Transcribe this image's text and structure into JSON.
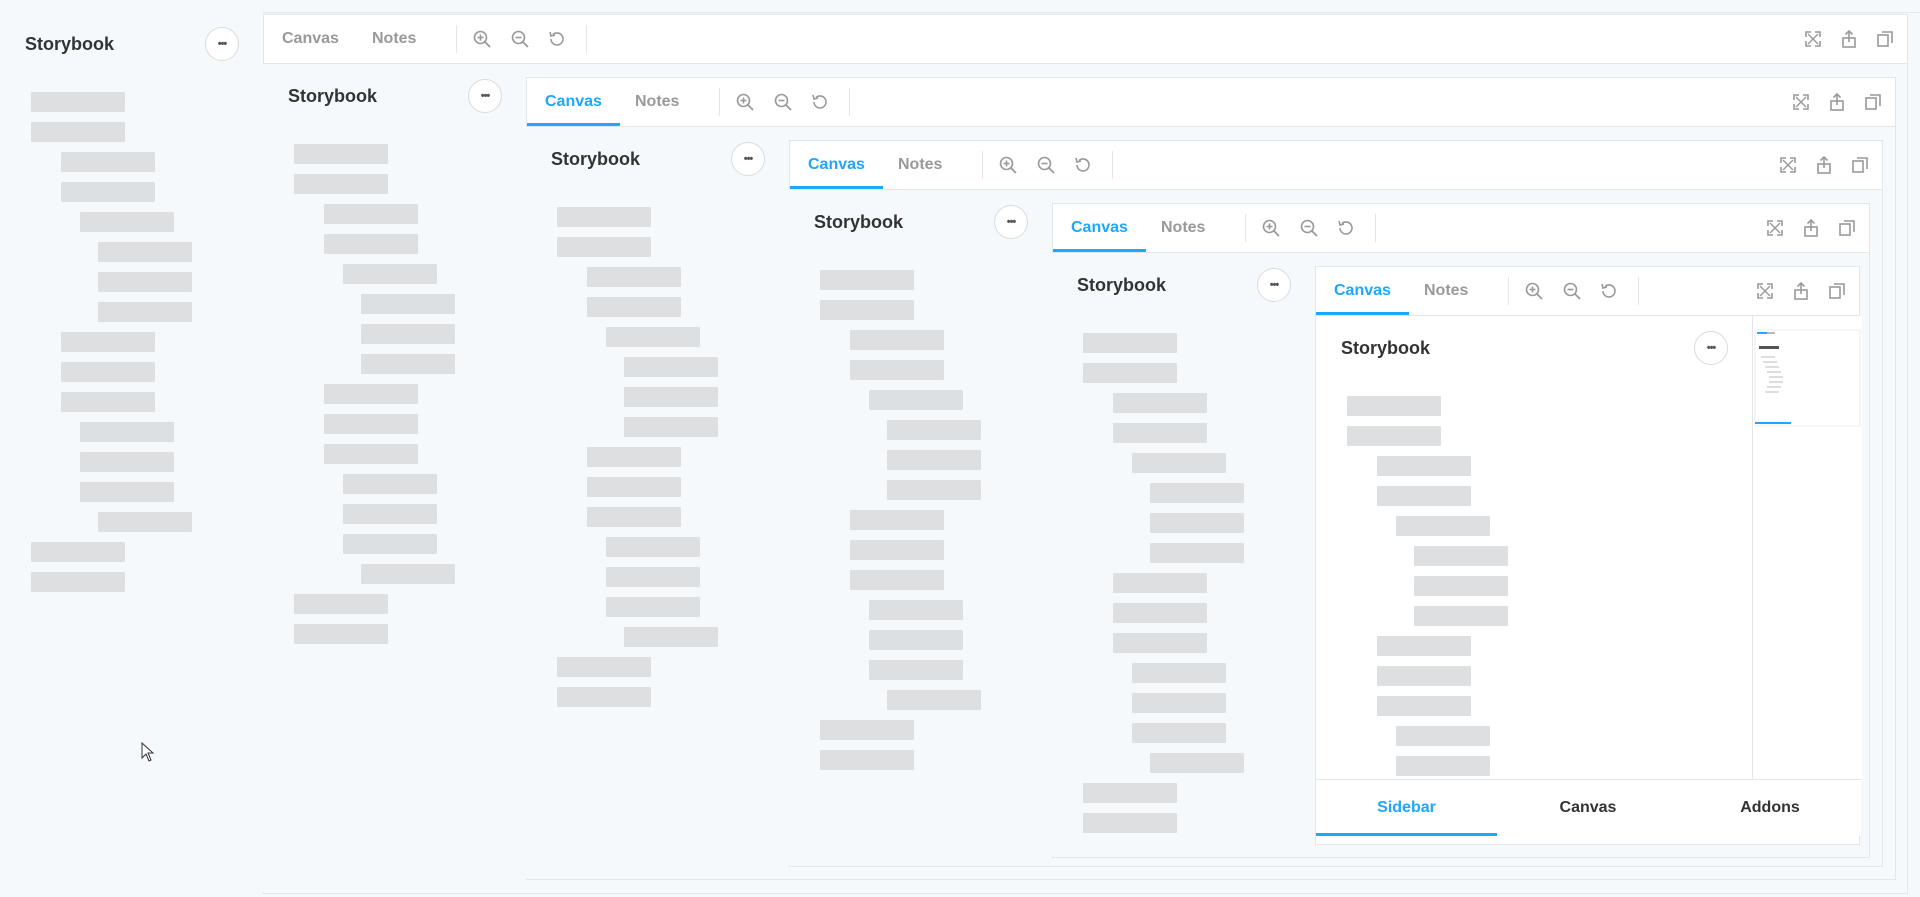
{
  "sidebar": {
    "title": "Storybook",
    "menu_label": "•••"
  },
  "toolbar": {
    "tab_canvas": "Canvas",
    "tab_notes": "Notes"
  },
  "bottom_nav": {
    "sidebar": "Sidebar",
    "canvas": "Canvas",
    "addons": "Addons"
  },
  "colors": {
    "accent": "#1ea7fd",
    "placeholder": "#dedfe1",
    "background": "#f6f9fc"
  },
  "icons": [
    "zoom-in-icon",
    "zoom-out-icon",
    "reset-zoom-icon",
    "fullscreen-icon",
    "share-icon",
    "copy-icon"
  ]
}
